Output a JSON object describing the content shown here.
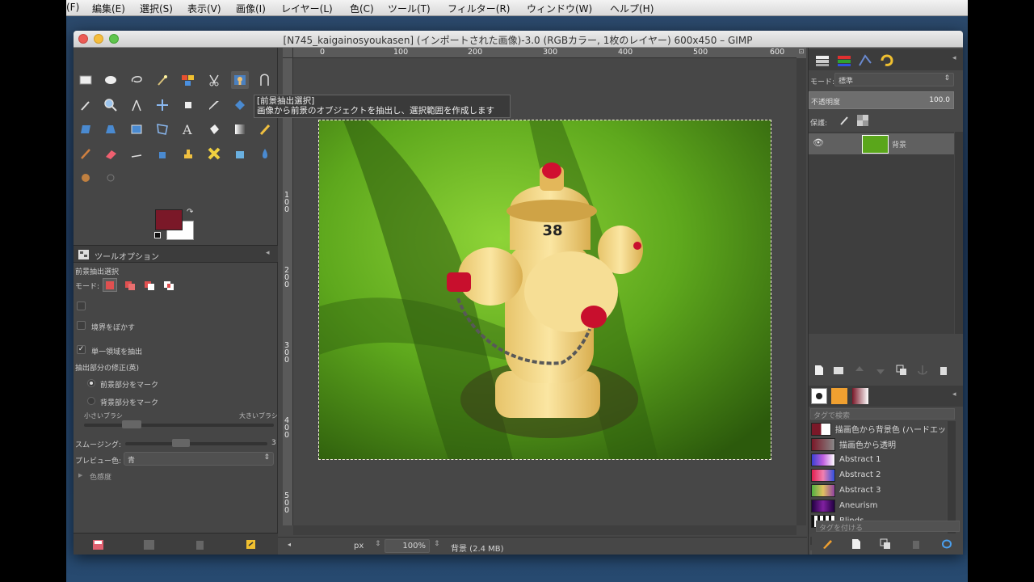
{
  "menubar": {
    "items": [
      "(F)",
      "編集(E)",
      "選択(S)",
      "表示(V)",
      "画像(I)",
      "レイヤー(L)",
      "色(C)",
      "ツール(T)",
      "フィルター(R)",
      "ウィンドウ(W)",
      "ヘルプ(H)"
    ]
  },
  "window": {
    "title": "[N745_kaigainosyoukasen] (インポートされた画像)-3.0 (RGBカラー, 1枚のレイヤー) 600x450 – GIMP"
  },
  "tooltip": {
    "line1": "[前景抽出選択]",
    "line2": "画像から前景のオブジェクトを抽出し、選択範囲を作成します"
  },
  "colors": {
    "foreground": "#7a1828",
    "background": "#ffffff"
  },
  "tool_options": {
    "tab_label": "ツールオプション",
    "tool_name": "前景抽出選択",
    "mode_label": "モード:",
    "feather_label": "境界をぼかす",
    "single_region_label": "単一領域を抽出",
    "single_region_checked": true,
    "refinement_label": "抽出部分の修正(英)",
    "radio_fg": "前景部分をマーク",
    "radio_bg": "背景部分をマーク",
    "brush_small": "小さいブラシ",
    "brush_large": "大きいブラシ",
    "smoothing_label": "スムージング:",
    "smoothing_value": "3",
    "preview_color_label": "プレビュー色:",
    "preview_color_value": "青",
    "sensitivity_label": "色感度"
  },
  "rulers": {
    "top": [
      "0",
      "100",
      "200",
      "300",
      "400",
      "500",
      "600"
    ],
    "left": [
      "100",
      "200",
      "300",
      "400",
      "500"
    ]
  },
  "image_text": {
    "hydrant_number": "38"
  },
  "statusbar": {
    "unit": "px",
    "zoom": "100%",
    "layer_info": "背景 (2.4 MB)"
  },
  "layers_panel": {
    "mode_label": "モード:",
    "mode_value": "標準",
    "opacity_label": "不透明度",
    "opacity_value": "100.0",
    "lock_label": "保護:",
    "layer_name": "背景"
  },
  "gradients_panel": {
    "tag_search_placeholder": "タグで検索",
    "items": [
      {
        "name": "描画色から背景色 (ハードエッ",
        "color": "#7a1828"
      },
      {
        "name": "描画色から透明",
        "color": "#7a1828"
      },
      {
        "name": "Abstract 1",
        "color": "#5060e0"
      },
      {
        "name": "Abstract 2",
        "color": "#e02050"
      },
      {
        "name": "Abstract 3",
        "color": "#90c040"
      },
      {
        "name": "Aneurism",
        "color": "#602080"
      },
      {
        "name": "Blinds",
        "color": "#aaaaaa"
      }
    ],
    "tag_assign_placeholder": "タグを付ける"
  }
}
